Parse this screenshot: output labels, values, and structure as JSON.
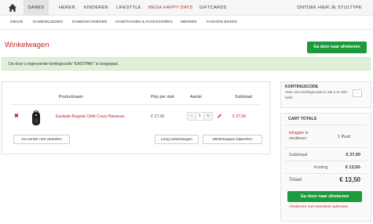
{
  "nav": {
    "home_icon": "home-icon",
    "items": [
      "DAMES",
      "HEREN",
      "KINDEREN",
      "LIFESTYLE",
      "MEGA HAPPY DAYS",
      "GIFTCARDS"
    ],
    "right_link": "ONTDEK HIER JE STIJLTYPE",
    "sale_color": "#c0262a"
  },
  "subnav": {
    "items": [
      "NIEUW",
      "DAMESKLEDING",
      "DAMESSCHOENEN",
      "HANDTASSEN & ACCESSOIRES",
      "MERKEN",
      "FASHION BOXES"
    ]
  },
  "page": {
    "title": "Winkelwagen",
    "checkout_button": "Ga door naar afrekenen",
    "notice": "De door u ingevoerde kortingscode \"EASTPAK\" is toegepast."
  },
  "cart": {
    "headers": {
      "product": "Productnaam",
      "price": "Prijs per stuk",
      "qty": "Aantal",
      "subtotal": "Subtotaal"
    },
    "items": [
      {
        "name": "Eastpak-Rugzak Orbit Crazy Bananas",
        "price": "€ 27,00",
        "qty": "1",
        "subtotal": "€ 27,00",
        "remove_icon": "remove-icon",
        "edit_icon": "pencil-icon"
      }
    ],
    "qty_minus": "−",
    "qty_plus": "+",
    "continue_button": "Ga verder met winkelen",
    "clear_button": "Leeg winkelwagen",
    "update_button": "Winkelwagen bijwerken"
  },
  "coupon": {
    "title": "KORTINGSCODE",
    "text": "Voer een kortingscode in als u er één hebt.",
    "button_icon": "chevron-right-icon"
  },
  "totals": {
    "title": "CART TOTALS",
    "login_link": "Inloggen",
    "login_rest": " to verdienen:",
    "points": "1 Punt",
    "subtotal_label": "Subtotaal",
    "subtotal_value": "€ 27,00",
    "discount_label": "Korting",
    "discount_value": "€ 13,50-",
    "total_label": "Totaal",
    "total_value": "€ 13,50",
    "checkout_button": "Ga door naar afrekenen",
    "multi_address_link": "Afrekenen met meerdere adressen"
  },
  "colors": {
    "accent": "#c0262a",
    "green": "#1d9a3d",
    "notice_bg": "#dff0d8"
  }
}
